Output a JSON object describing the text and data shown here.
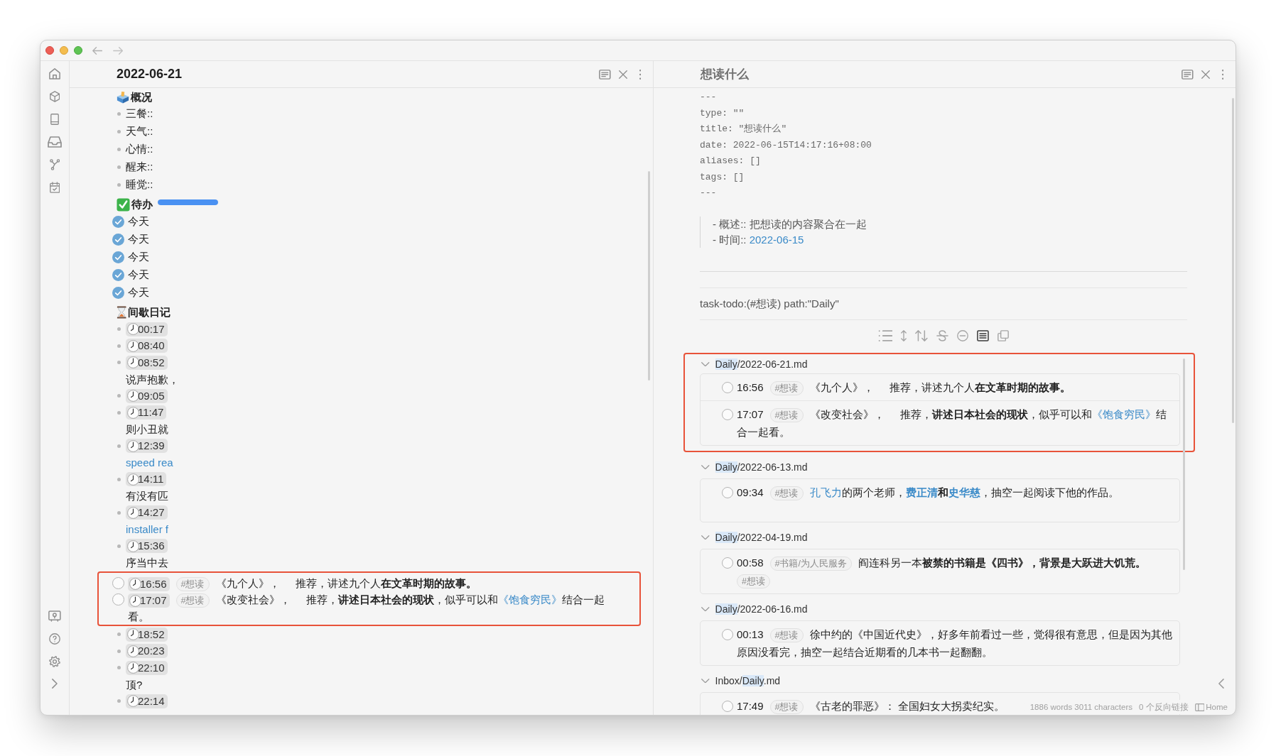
{
  "left_pane": {
    "title": "2022-06-21",
    "active": true,
    "sections": [
      {
        "kind": "properties",
        "heading": "概况",
        "items": [
          "三餐::",
          "天气::",
          "心情::",
          "醒来::",
          "睡觉::"
        ]
      },
      {
        "kind": "todo",
        "heading": "待办",
        "progress": {
          "level": 1
        },
        "items": [
          {
            "text": "今天",
            "checked": true
          },
          {
            "text": "今天",
            "checked": true
          },
          {
            "text": "今天",
            "checked": true
          },
          {
            "text": "今天",
            "checked": true
          },
          {
            "text": "今天",
            "checked": true
          }
        ]
      },
      {
        "kind": "journal",
        "heading": "间歇日记",
        "entries": [
          {
            "kind": "bullet",
            "time": "00:17",
            "highlighted": false
          },
          {
            "kind": "bullet",
            "time": "08:40",
            "highlighted": false
          },
          {
            "kind": "bullet",
            "time": "08:52",
            "highlighted": false,
            "continuation": {
              "text": "说声抱歉，",
              "link": false
            }
          },
          {
            "kind": "bullet",
            "time": "09:05",
            "highlighted": false
          },
          {
            "kind": "bullet",
            "time": "11:47",
            "highlighted": false,
            "continuation": {
              "text": "则小丑就",
              "link": false
            }
          },
          {
            "kind": "bullet",
            "time": "12:39",
            "highlighted": false,
            "continuation": {
              "text": "speed rea",
              "link": true
            }
          },
          {
            "kind": "bullet",
            "time": "14:11",
            "highlighted": false,
            "continuation": {
              "text": "有没有匹",
              "link": false
            }
          },
          {
            "kind": "bullet",
            "time": "14:27",
            "highlighted": false,
            "continuation": {
              "text": "installer f",
              "link": true
            }
          },
          {
            "kind": "bullet",
            "time": "15:36",
            "highlighted": false,
            "continuation": {
              "text": "序当中去",
              "link": false
            }
          },
          {
            "kind": "task",
            "time": "16:56",
            "highlighted": true,
            "checked": false,
            "parts": [
              {
                "kind": "tag",
                "text": "#想读"
              },
              {
                "kind": "title",
                "text": "《九个人》，"
              },
              {
                "kind": "sentence",
                "segments": [
                  {
                    "text": "推荐，讲述九个人**在文革时期的故事。**",
                    "link": false
                  }
                ]
              }
            ]
          },
          {
            "kind": "task",
            "time": "17:07",
            "highlighted": true,
            "checked": false,
            "parts": [
              {
                "kind": "tag",
                "text": "#想读"
              },
              {
                "kind": "title",
                "text": "《改变社会》，"
              },
              {
                "kind": "sentence",
                "segments": [
                  {
                    "text": "推荐，**讲述日本社会的现状**，似乎可以和",
                    "link": false
                  },
                  {
                    "text": "《饱食穷民》",
                    "link": true
                  },
                  {
                    "text": "结合一起看。",
                    "link": false
                  }
                ]
              }
            ]
          },
          {
            "kind": "bullet",
            "time": "18:52",
            "highlighted": false
          },
          {
            "kind": "bullet",
            "time": "20:23",
            "highlighted": false
          },
          {
            "kind": "bullet",
            "time": "22:10",
            "highlighted": false,
            "continuation": {
              "text": "顶?",
              "link": false
            }
          },
          {
            "kind": "bullet",
            "time": "22:14",
            "highlighted": false
          }
        ]
      }
    ]
  },
  "right_pane": {
    "title": "想读什么",
    "active": false,
    "frontmatter": [
      "---",
      "type: \"\"",
      "title: \"想读什么\"",
      "date: 2022-06-15T14:17:16+08:00",
      "aliases: []",
      "tags: []",
      "---"
    ],
    "quote": [
      {
        "segments": [
          {
            "text": "- 概述:: 把想读的内容聚合在一起",
            "link": false
          }
        ]
      },
      {
        "segments": [
          {
            "text": "- 时间:: ",
            "link": false
          },
          {
            "text": "2022-06-15",
            "link": true
          }
        ]
      }
    ],
    "query": "task-todo:(#想读) path:\"Daily\"",
    "toolbar": [
      {
        "selected": false
      },
      {
        "selected": false
      },
      {
        "selected": false
      },
      {
        "selected": false
      },
      {
        "selected": false
      },
      {
        "selected": true
      },
      {
        "selected": false
      }
    ],
    "groups": [
      {
        "expanded": true,
        "highlighted": true,
        "path": [
          {
            "text": "Daily",
            "match": true
          },
          {
            "text": "/2022-06-21.md",
            "match": false
          }
        ],
        "tasks": [
          {
            "checked": false,
            "time": "16:56",
            "parts": [
              {
                "kind": "tag",
                "text": "#想读"
              },
              {
                "kind": "title",
                "text": "《九个人》，"
              },
              {
                "kind": "sentence",
                "segments": [
                  {
                    "text": "推荐，讲述九个人**在文革时期的故事。**",
                    "link": false
                  }
                ]
              }
            ]
          },
          {
            "checked": false,
            "time": "17:07",
            "parts": [
              {
                "kind": "tag",
                "text": "#想读"
              },
              {
                "kind": "title",
                "text": "《改变社会》，"
              },
              {
                "kind": "sentence",
                "segments": [
                  {
                    "text": "推荐，**讲述日本社会的现状**，似乎可以和",
                    "link": false
                  },
                  {
                    "text": "《饱食穷民》",
                    "link": true
                  },
                  {
                    "text": "结合一起看。",
                    "link": false
                  }
                ]
              }
            ]
          }
        ]
      },
      {
        "expanded": true,
        "highlighted": false,
        "path": [
          {
            "text": "Daily",
            "match": true
          },
          {
            "text": "/2022-06-13.md",
            "match": false
          }
        ],
        "tasks": [
          {
            "checked": false,
            "time": "09:34",
            "parts": [
              {
                "kind": "tag",
                "text": "#想读"
              },
              {
                "kind": "sentence",
                "segments": [
                  {
                    "text": "孔飞力",
                    "link": true
                  },
                  {
                    "text": "的两个老师，",
                    "link": false
                  },
                  {
                    "text": "**费正清**",
                    "link": true
                  },
                  {
                    "text": "**和**",
                    "link": false
                  },
                  {
                    "text": "**史华慈**",
                    "link": true
                  },
                  {
                    "text": "，抽空一起阅读下他的作品。",
                    "link": false
                  }
                ]
              }
            ]
          }
        ]
      },
      {
        "expanded": true,
        "highlighted": false,
        "path": [
          {
            "text": "Daily",
            "match": true
          },
          {
            "text": "/2022-04-19.md",
            "match": false
          }
        ],
        "tasks": [
          {
            "checked": false,
            "time": "00:58",
            "parts": [
              {
                "kind": "tag",
                "text": "#书籍/为人民服务"
              },
              {
                "kind": "sentence",
                "segments": [
                  {
                    "text": "阎连科另一本**被禁的书籍是《四书》，背景是大跃进大饥荒。**",
                    "link": false
                  }
                ]
              },
              {
                "kind": "tag",
                "text": "#想读"
              }
            ]
          }
        ]
      },
      {
        "expanded": true,
        "highlighted": false,
        "path": [
          {
            "text": "Daily",
            "match": true
          },
          {
            "text": "/2022-06-16.md",
            "match": false
          }
        ],
        "tasks": [
          {
            "checked": false,
            "time": "00:13",
            "parts": [
              {
                "kind": "tag",
                "text": "#想读"
              },
              {
                "kind": "sentence",
                "segments": [
                  {
                    "text": "徐中约的《中国近代史》，好多年前看过一些，觉得很有意思，但是因为其他原因没看完，抽空一起结合近期看的几本书一起翻翻。",
                    "link": false
                  }
                ]
              }
            ]
          }
        ]
      },
      {
        "expanded": true,
        "highlighted": false,
        "path": [
          {
            "text": "Inbox/",
            "match": false
          },
          {
            "text": "Daily",
            "match": true
          },
          {
            "text": ".md",
            "match": false
          }
        ],
        "tasks": [
          {
            "checked": false,
            "time": "17:49",
            "parts": [
              {
                "kind": "tag",
                "text": "#想读"
              },
              {
                "kind": "sentence",
                "segments": [
                  {
                    "text": "《古老的罪恶》： 全国妇女大拐卖纪实。",
                    "link": false
                  }
                ]
              }
            ]
          }
        ]
      }
    ]
  },
  "status_bar": {
    "word_count": "1886 words 3011 characters",
    "backlinks": "0 个反向链接",
    "home": "Home"
  }
}
